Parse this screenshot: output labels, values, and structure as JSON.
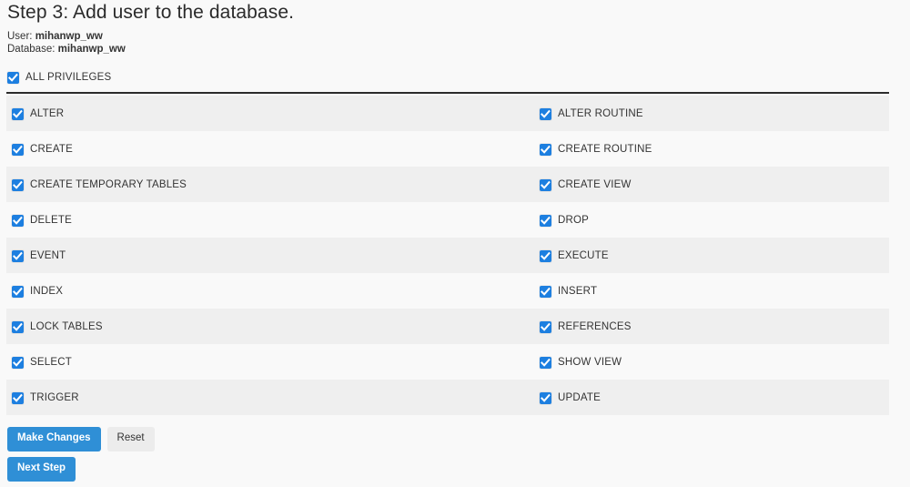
{
  "header": {
    "title": "Step 3: Add user to the database.",
    "user_label": "User:",
    "user_value": "mihanwp_ww",
    "database_label": "Database:",
    "database_value": "mihanwp_ww"
  },
  "all_privileges": {
    "label": "ALL PRIVILEGES",
    "checked": true
  },
  "privileges": {
    "rows": [
      {
        "left": {
          "label": "ALTER",
          "checked": true
        },
        "right": {
          "label": "ALTER ROUTINE",
          "checked": true
        }
      },
      {
        "left": {
          "label": "CREATE",
          "checked": true
        },
        "right": {
          "label": "CREATE ROUTINE",
          "checked": true
        }
      },
      {
        "left": {
          "label": "CREATE TEMPORARY TABLES",
          "checked": true
        },
        "right": {
          "label": "CREATE VIEW",
          "checked": true
        }
      },
      {
        "left": {
          "label": "DELETE",
          "checked": true
        },
        "right": {
          "label": "DROP",
          "checked": true
        }
      },
      {
        "left": {
          "label": "EVENT",
          "checked": true
        },
        "right": {
          "label": "EXECUTE",
          "checked": true
        }
      },
      {
        "left": {
          "label": "INDEX",
          "checked": true
        },
        "right": {
          "label": "INSERT",
          "checked": true
        }
      },
      {
        "left": {
          "label": "LOCK TABLES",
          "checked": true
        },
        "right": {
          "label": "REFERENCES",
          "checked": true
        }
      },
      {
        "left": {
          "label": "SELECT",
          "checked": true
        },
        "right": {
          "label": "SHOW VIEW",
          "checked": true
        }
      },
      {
        "left": {
          "label": "TRIGGER",
          "checked": true
        },
        "right": {
          "label": "UPDATE",
          "checked": true
        }
      }
    ]
  },
  "actions": {
    "make_changes_label": "Make Changes",
    "reset_label": "Reset",
    "next_step_label": "Next Step"
  },
  "colors": {
    "primary_button": "#2f8fd6",
    "checkbox": "#1d7fe0",
    "default_button": "#ececec",
    "page_background": "#f9f9f9",
    "row_stripe": "#efefef",
    "rule": "#2b2b2b"
  },
  "icons": {
    "checkbox_check": "check-icon"
  }
}
